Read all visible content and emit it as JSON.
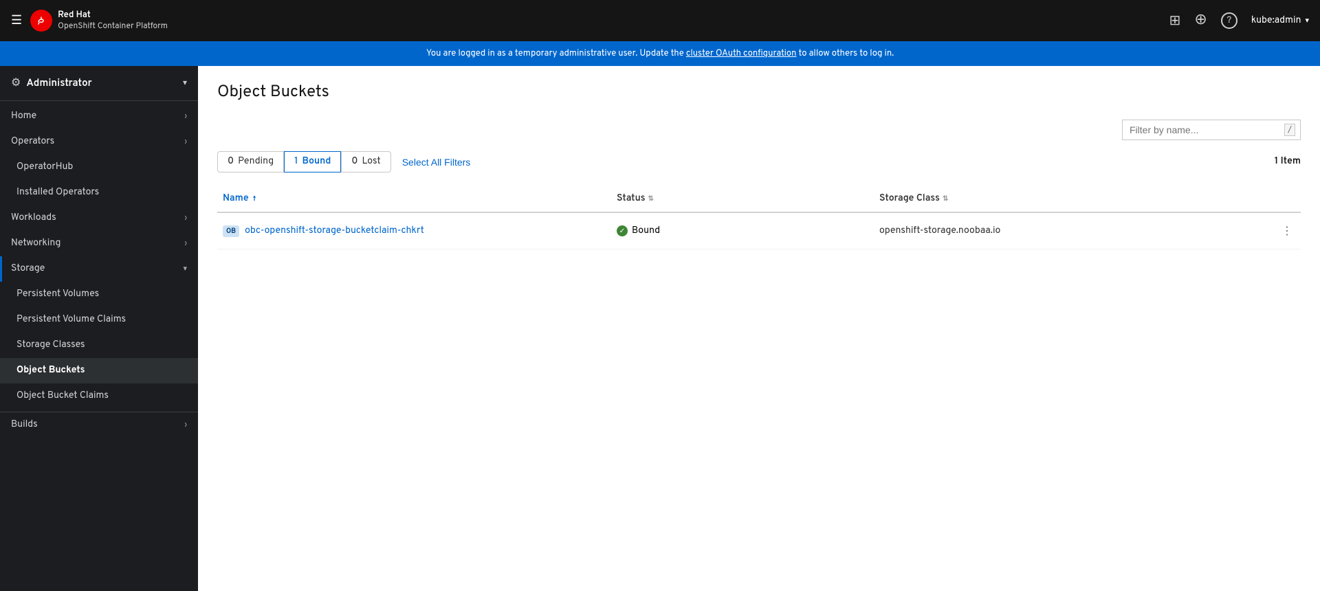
{
  "topbar": {
    "hamburger_label": "☰",
    "logo_initials": "RH",
    "logo_line1": "Red Hat",
    "logo_line2": "OpenShift Container Platform",
    "apps_icon": "⊞",
    "plus_icon": "+",
    "help_icon": "?",
    "user_label": "kube:admin",
    "user_chevron": "▾"
  },
  "banner": {
    "message": "You are logged in as a temporary administrative user. Update the ",
    "link_text": "cluster OAuth configuration",
    "message_end": " to allow others to log in."
  },
  "sidebar": {
    "role_label": "Administrator",
    "role_chevron": "▾",
    "items": [
      {
        "label": "Home",
        "chevron": "›",
        "level": "top"
      },
      {
        "label": "Operators",
        "chevron": "›",
        "level": "top"
      },
      {
        "label": "OperatorHub",
        "chevron": "",
        "level": "sub"
      },
      {
        "label": "Installed Operators",
        "chevron": "",
        "level": "sub"
      },
      {
        "label": "Workloads",
        "chevron": "›",
        "level": "top"
      },
      {
        "label": "Networking",
        "chevron": "›",
        "level": "top"
      },
      {
        "label": "Storage",
        "chevron": "▾",
        "level": "top",
        "active": true
      },
      {
        "label": "Persistent Volumes",
        "chevron": "",
        "level": "sub"
      },
      {
        "label": "Persistent Volume Claims",
        "chevron": "",
        "level": "sub"
      },
      {
        "label": "Storage Classes",
        "chevron": "",
        "level": "sub"
      },
      {
        "label": "Object Buckets",
        "chevron": "",
        "level": "sub",
        "active_page": true
      },
      {
        "label": "Object Bucket Claims",
        "chevron": "",
        "level": "sub"
      },
      {
        "label": "Builds",
        "chevron": "›",
        "level": "top"
      }
    ]
  },
  "page": {
    "title": "Object Buckets",
    "filter_placeholder": "Filter by name...",
    "filter_slash": "/",
    "filters": [
      {
        "count": "0",
        "label": "Pending",
        "active": false
      },
      {
        "count": "1",
        "label": "Bound",
        "active": true
      },
      {
        "count": "0",
        "label": "Lost",
        "active": false
      }
    ],
    "select_all_label": "Select All Filters",
    "item_count": "1 Item",
    "table": {
      "columns": [
        {
          "label": "Name",
          "sort": "asc"
        },
        {
          "label": "Status",
          "sort": "none"
        },
        {
          "label": "Storage Class",
          "sort": "none"
        }
      ],
      "rows": [
        {
          "badge": "OB",
          "name": "obc-openshift-storage-bucketclaim-chkrt",
          "status": "Bound",
          "storage_class": "openshift-storage.noobaa.io"
        }
      ]
    }
  }
}
